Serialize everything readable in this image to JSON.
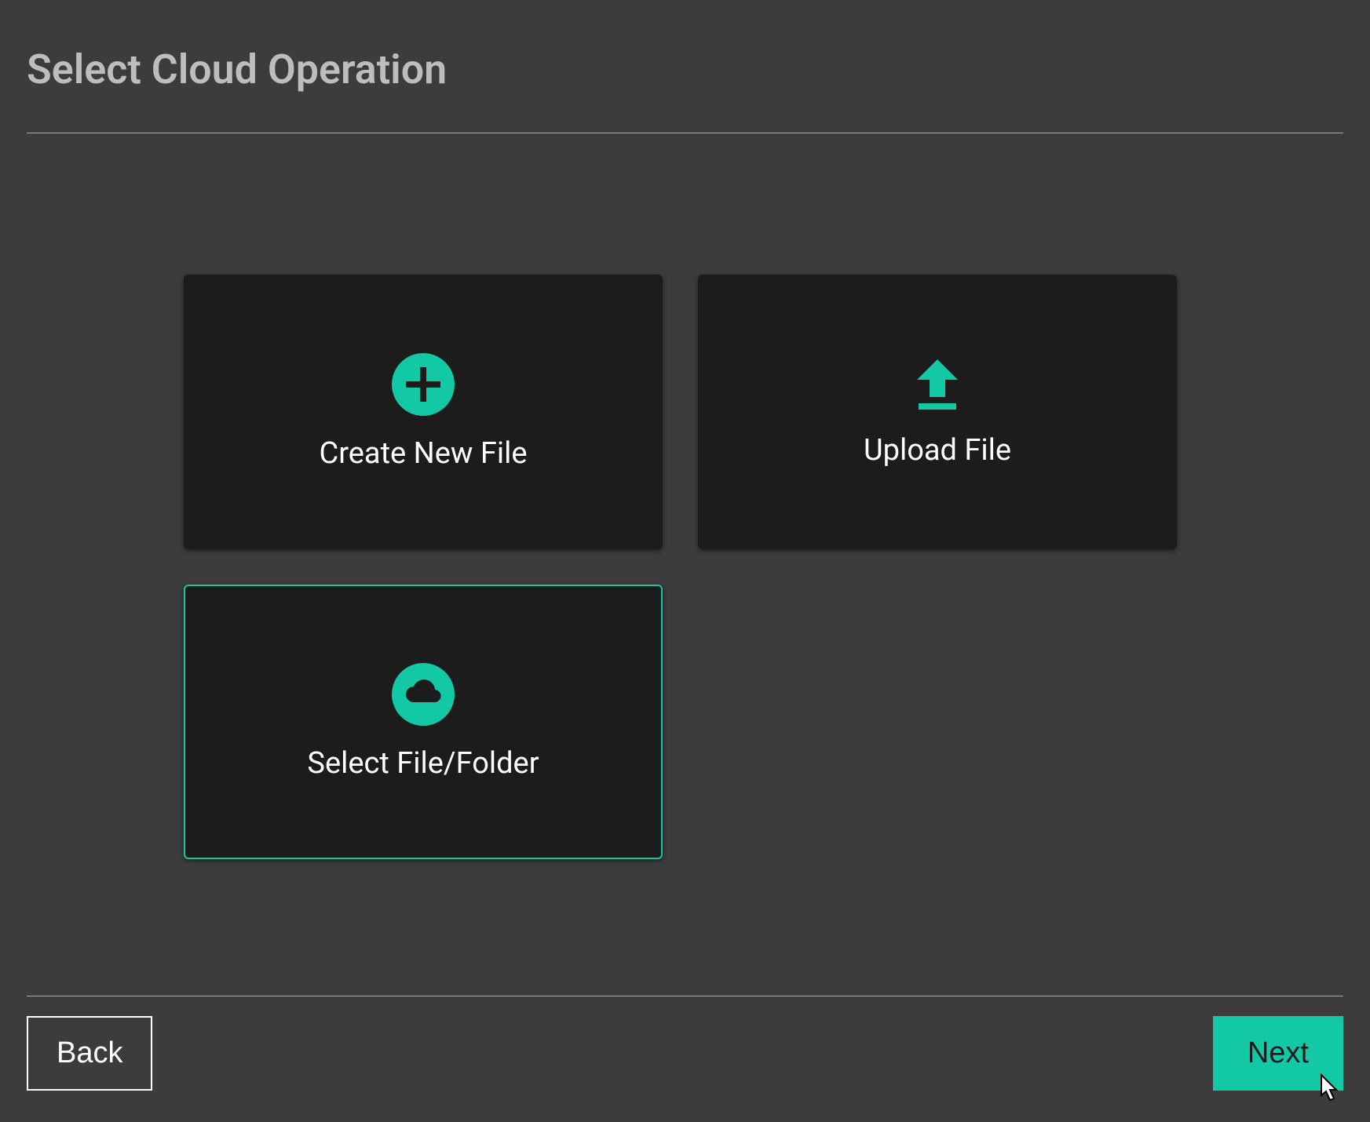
{
  "header": {
    "title": "Select Cloud Operation"
  },
  "cards": {
    "create": {
      "label": "Create New File",
      "icon": "plus-circle-icon",
      "selected": false
    },
    "upload": {
      "label": "Upload File",
      "icon": "upload-icon",
      "selected": false
    },
    "select": {
      "label": "Select File/Folder",
      "icon": "cloud-circle-icon",
      "selected": true
    }
  },
  "footer": {
    "back_label": "Back",
    "next_label": "Next"
  },
  "colors": {
    "accent": "#13c8a5",
    "card_bg": "#1c1c1c",
    "page_bg": "#3c3c3c"
  }
}
